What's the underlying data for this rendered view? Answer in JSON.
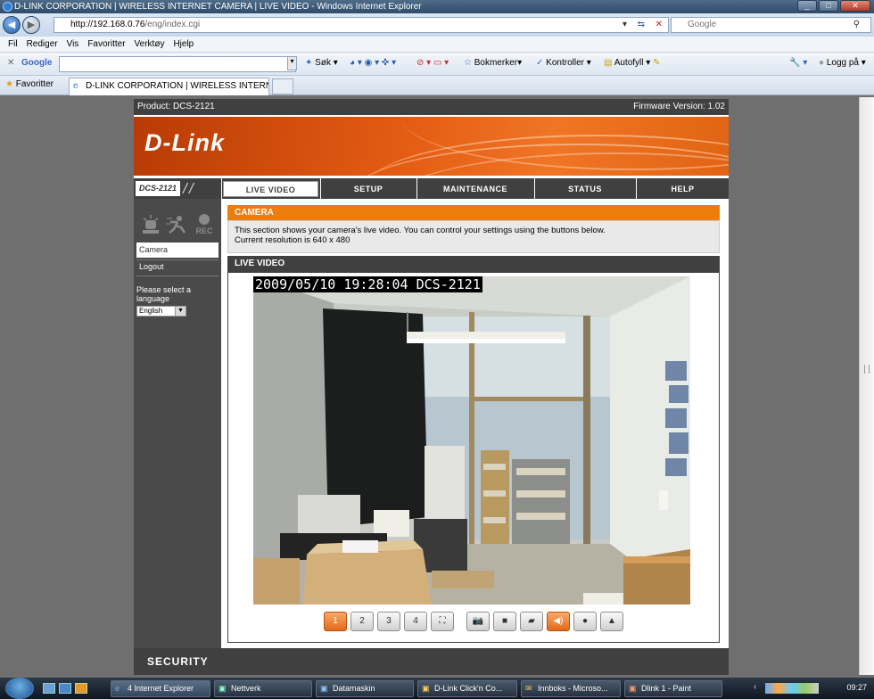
{
  "window": {
    "title": "D-LINK CORPORATION | WIRELESS INTERNET CAMERA | LIVE VIDEO - Windows Internet Explorer"
  },
  "address": {
    "host": "http://192.168.0.76",
    "path": "/eng/index.cgi",
    "search_placeholder": "Google"
  },
  "menu": [
    "Fil",
    "Rediger",
    "Vis",
    "Favoritter",
    "Verktøy",
    "Hjelp"
  ],
  "google_toolbar": {
    "brand": "Google",
    "search": "Søk",
    "bookmarks": "Bokmerker",
    "check": "Kontroller",
    "autofill": "Autofyll",
    "login": "Logg på"
  },
  "favorites": {
    "label": "Favoritter",
    "tab_title": "D-LINK CORPORATION | WIRELESS INTERNET CA..."
  },
  "product": {
    "label": "Product: DCS-2121",
    "firmware": "Firmware Version: 1.02"
  },
  "brand": {
    "logo": "D-Link",
    "model": "DCS-2121"
  },
  "nav": [
    "LIVE VIDEO",
    "SETUP",
    "MAINTENANCE",
    "STATUS",
    "HELP"
  ],
  "sidebar": {
    "icon_rec": "REC",
    "items": [
      "Camera",
      "Logout"
    ],
    "language_label": "Please select a language",
    "language_value": "English"
  },
  "camera": {
    "heading": "CAMERA",
    "line1": "This section shows your camera's live video. You can control your settings using the buttons below.",
    "line2": "Current resolution is 640 x 480"
  },
  "live": {
    "heading": "LIVE VIDEO",
    "timestamp": "2009/05/10 19:28:04 DCS-2121"
  },
  "controls": [
    {
      "icon": "view-1-icon",
      "label": "1",
      "active": true
    },
    {
      "icon": "view-2-icon",
      "label": "2",
      "active": false
    },
    {
      "icon": "view-3-icon",
      "label": "3",
      "active": false
    },
    {
      "icon": "view-4-icon",
      "label": "4",
      "active": false
    },
    {
      "icon": "fullscreen-icon",
      "label": "",
      "active": false
    },
    {
      "icon": "snapshot-icon",
      "label": "",
      "active": false
    },
    {
      "icon": "record-icon",
      "label": "",
      "active": false
    },
    {
      "icon": "storage-icon",
      "label": "",
      "active": false
    },
    {
      "icon": "speaker-icon",
      "label": "",
      "active": true
    },
    {
      "icon": "microphone-icon",
      "label": "",
      "active": false
    },
    {
      "icon": "alert-icon",
      "label": "",
      "active": false
    }
  ],
  "footer": {
    "label": "SECURITY"
  },
  "taskbar": {
    "items": [
      "4 Internet Explorer",
      "Nettverk",
      "Datamaskin",
      "D-Link Click'n Co...",
      "Innboks - Microso...",
      "Dlink 1 - Paint"
    ],
    "clock": "09:27"
  },
  "colors": {
    "accent": "#ee7d10",
    "nav_bg": "#404040",
    "banner": "#e35c13"
  }
}
